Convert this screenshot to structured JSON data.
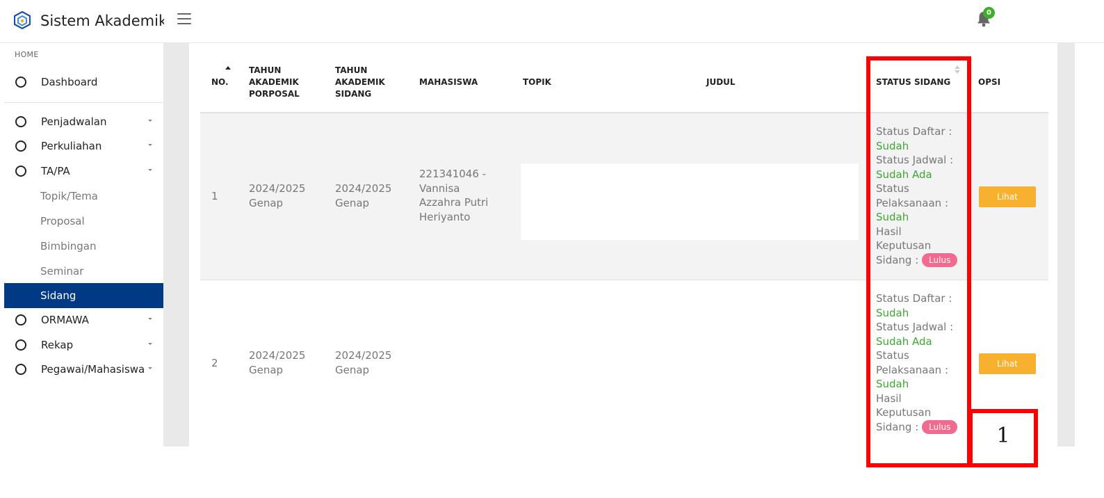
{
  "header": {
    "title": "Sistem Akademik",
    "notification_count": "0"
  },
  "sidebar": {
    "section": "HOME",
    "dashboard": "Dashboard",
    "items": [
      {
        "label": "Penjadwalan"
      },
      {
        "label": "Perkuliahan"
      },
      {
        "label": "TA/PA"
      }
    ],
    "subitems": [
      {
        "label": "Topik/Tema"
      },
      {
        "label": "Proposal"
      },
      {
        "label": "Bimbingan"
      },
      {
        "label": "Seminar"
      },
      {
        "label": "Sidang"
      }
    ],
    "items_after": [
      {
        "label": "ORMAWA"
      },
      {
        "label": "Rekap"
      },
      {
        "label": "Pegawai/Mahasiswa"
      }
    ]
  },
  "table": {
    "headers": {
      "no": "NO.",
      "tahun_proposal_1": "TAHUN",
      "tahun_proposal_2": "AKADEMIK",
      "tahun_proposal_3": "PORPOSAL",
      "tahun_sidang_1": "TAHUN",
      "tahun_sidang_2": "AKADEMIK",
      "tahun_sidang_3": "SIDANG",
      "mahasiswa": "MAHASISWA",
      "topik": "TOPIK",
      "judul": "JUDUL",
      "status": "STATUS SIDANG",
      "opsi": "OPSI"
    },
    "status_labels": {
      "daftar": "Status Daftar :",
      "jadwal": "Status Jadwal :",
      "pelaksanaan_1": "Status",
      "pelaksanaan_2": "Pelaksanaan :",
      "hasil_1": "Hasil",
      "hasil_2": "Keputusan",
      "hasil_3": "Sidang :"
    },
    "rows": [
      {
        "no": "1",
        "tahun_proposal_1": "2024/2025",
        "tahun_proposal_2": "Genap",
        "tahun_sidang_1": "2024/2025",
        "tahun_sidang_2": "Genap",
        "mahasiswa_1": "221341046 -",
        "mahasiswa_2": "Vannisa",
        "mahasiswa_3": "Azzahra Putri",
        "mahasiswa_4": "Heriyanto",
        "status_daftar": "Sudah",
        "status_jadwal": "Sudah Ada",
        "status_pelaksanaan": "Sudah",
        "hasil": "Lulus",
        "button": "Lihat"
      },
      {
        "no": "2",
        "tahun_proposal_1": "2024/2025",
        "tahun_proposal_2": "Genap",
        "tahun_sidang_1": "2024/2025",
        "tahun_sidang_2": "Genap",
        "status_daftar": "Sudah",
        "status_jadwal": "Sudah Ada",
        "status_pelaksanaan": "Sudah",
        "hasil": "Lulus",
        "button": "Lihat"
      }
    ]
  },
  "annotation": {
    "label": "1",
    "color": "#ff0000"
  },
  "colors": {
    "accent": "#003a84",
    "success_text": "#3fa535",
    "badge": "#f06b8e",
    "button": "#f7b12e"
  }
}
